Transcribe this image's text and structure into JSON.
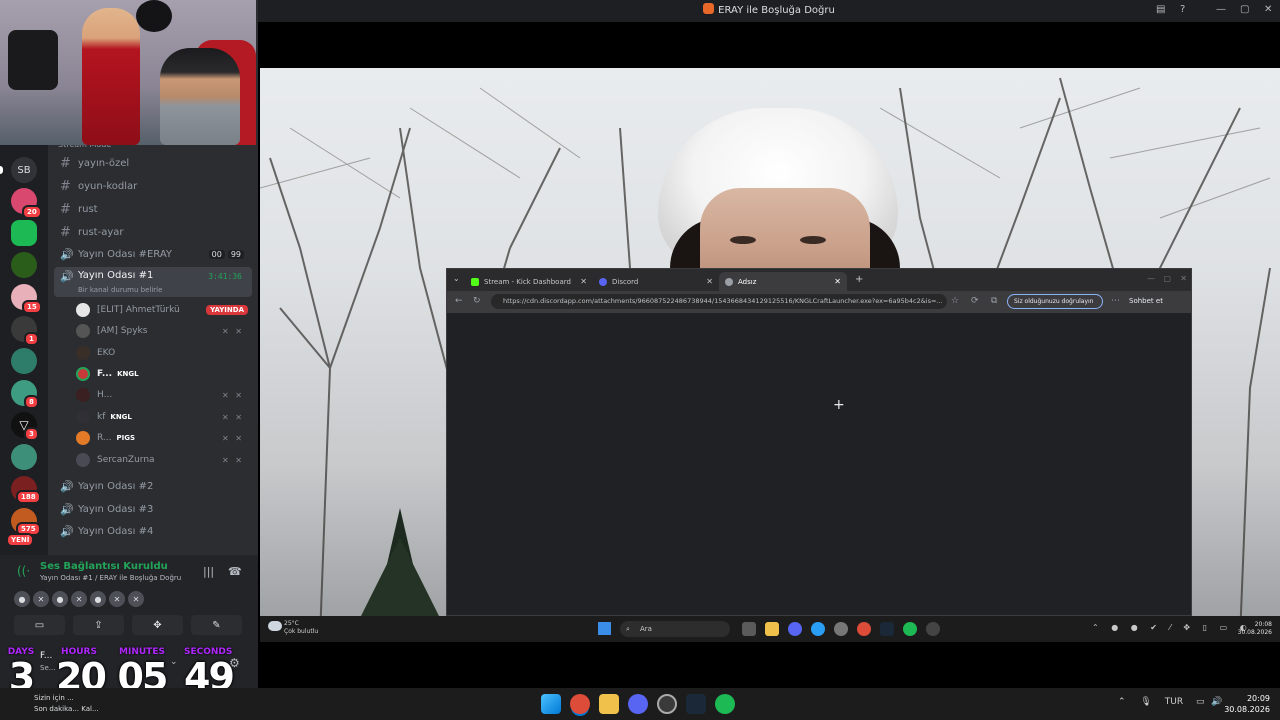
{
  "window": {
    "title": "ERAY ile Boşluğa Doğru"
  },
  "discord": {
    "category": "Stream Mode",
    "server_label": "SB",
    "server_badges": [
      "20",
      "15",
      "1",
      "8",
      "3",
      "188",
      "575",
      "YENİ"
    ],
    "channels": [
      {
        "name": "yayın-özel",
        "type": "text"
      },
      {
        "name": "oyun-kodlar",
        "type": "text"
      },
      {
        "name": "rust",
        "type": "text"
      },
      {
        "name": "rust-ayar",
        "type": "text"
      },
      {
        "name": "Yayın Odası #ERAY",
        "type": "voice",
        "meta": [
          "00",
          "99"
        ]
      },
      {
        "name": "Yayın Odası #1",
        "type": "voice",
        "timer": "3:41:36",
        "status": "Bir kanal durumu belirle"
      }
    ],
    "users": [
      {
        "name": "[ELIT] AhmetTürkü",
        "badge": "YAYINDA"
      },
      {
        "name": "[AM] Spyks",
        "icons": "✕ ✕"
      },
      {
        "name": "EKO"
      },
      {
        "name": "F...",
        "tag": "KNGL"
      },
      {
        "name": "H...",
        "icons": "✕ ✕"
      },
      {
        "name": "kf",
        "tag": "KNGL",
        "icons": "✕ ✕"
      },
      {
        "name": "R...",
        "tag": "PIGS",
        "icons": "✕ ✕"
      },
      {
        "name": "SercanZurna",
        "icons": "✕ ✕"
      }
    ],
    "more_channels": [
      "Yayın Odası #2",
      "Yayın Odası #3",
      "Yayın Odası #4"
    ],
    "voice": {
      "status": "Ses Bağlantısı Kuruldu",
      "location": "Yayın Odası #1 / ERAY ile Boşluğa Doğru"
    },
    "user_panel": {
      "name": "F...",
      "status": "Se..."
    },
    "notification": {
      "line1": "Sizin için ...",
      "line2": "Son dakika... Kal..."
    }
  },
  "countdown": {
    "labels": [
      "DAYS",
      "HOURS",
      "MINUTES",
      "SECONDS"
    ],
    "values": [
      "3",
      "20",
      "05",
      "49"
    ],
    "color": "#b026ff"
  },
  "browser": {
    "tabs": [
      {
        "label": "Stream - Kick Dashboard",
        "color": "#53fc18"
      },
      {
        "label": "Discord",
        "color": "#5865f2"
      },
      {
        "label": "Adsız",
        "color": "#9aa0a6"
      }
    ],
    "url": "https://cdn.discordapp.com/attachments/966087522486738944/1543668434129125516/KNGLCraftLauncher.exe?ex=6a95b4c2&is=...",
    "verify": "Siz olduğunuzu doğrulayın",
    "chat": "Sohbet et"
  },
  "inner_taskbar": {
    "temperature": "25°C",
    "weather": "Çok bulutlu",
    "search": "Ara",
    "time": "20:08",
    "date": "30.08.2026"
  },
  "taskbar": {
    "language": "TUR",
    "time": "20:09",
    "date": "30.08.2026"
  }
}
